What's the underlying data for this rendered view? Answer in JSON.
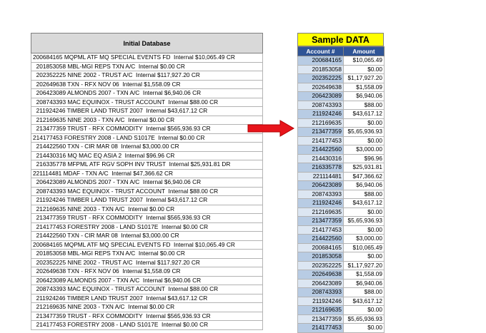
{
  "left": {
    "header": "Initial Database",
    "rows": [
      "200684165 MQPML ATF MQ SPECIAL EVENTS FD  Internal $10,065.49 CR",
      "  201853058 MBL-MGI REPS TXN A/C  Internal $0.00 CR",
      "  202352225 NINE 2002 - TRUST A/C  Internal $117,927.20 CR",
      "  202649638 TXN - RFX NOV 06  Internal $1,558.09 CR",
      "  206423089 ALMONDS 2007 - TXN A/C  Internal $6,940.06 CR",
      "  208743393 MAC EQUINOX - TRUST ACCOUNT  Internal $88.00 CR",
      "  211924246 TIMBER LAND TRUST 2007  Internal $43,617.12 CR",
      "  212169635 NINE 2003 - TXN A/C  Internal $0.00 CR",
      "  213477359 TRUST - RFX COMMODITY  Internal $565,936.93 CR",
      "214177453 FORESTRY 2008 - LAND S1017E  Internal $0.00 CR",
      "  214422560 TXN - CIR MAR 08  Internal $3,000.00 CR",
      "  214430316 MQ MAC EQ ASIA 2  Internal $96.96 CR",
      "  216335778 MFPML ATF RGV SOPH INV TRUST  Internal $25,931.81 DR",
      "221114481 MDAF - TXN A/C  Internal $47,366.62 CR",
      "  206423089 ALMONDS 2007 - TXN A/C  Internal $6,940.06 CR",
      "  208743393 MAC EQUINOX - TRUST ACCOUNT  Internal $88.00 CR",
      "  211924246 TIMBER LAND TRUST 2007  Internal $43,617.12 CR",
      "  212169635 NINE 2003 - TXN A/C  Internal $0.00 CR",
      "  213477359 TRUST - RFX COMMODITY  Internal $565,936.93 CR",
      "  214177453 FORESTRY 2008 - LAND S1017E  Internal $0.00 CR",
      "  214422560 TXN - CIR MAR 08  Internal $3,000.00 CR",
      "200684165 MQPML ATF MQ SPECIAL EVENTS FD  Internal $10,065.49 CR",
      "  201853058 MBL-MGI REPS TXN A/C  Internal $0.00 CR",
      "  202352225 NINE 2002 - TRUST A/C  Internal $117,927.20 CR",
      "  202649638 TXN - RFX NOV 06  Internal $1,558.09 CR",
      "  206423089 ALMONDS 2007 - TXN A/C  Internal $6,940.06 CR",
      "  208743393 MAC EQUINOX - TRUST ACCOUNT  Internal $88.00 CR",
      "  211924246 TIMBER LAND TRUST 2007  Internal $43,617.12 CR",
      "  212169635 NINE 2003 - TXN A/C  Internal $0.00 CR",
      "  213477359 TRUST - RFX COMMODITY  Internal $565,936.93 CR",
      "  214177453 FORESTRY 2008 - LAND S1017E  Internal $0.00 CR"
    ]
  },
  "right": {
    "title": "Sample DATA",
    "col_account": "Account #",
    "col_amount": "Amount",
    "rows": [
      {
        "account": "200684165",
        "amount": "$10,065.49",
        "hl": true
      },
      {
        "account": "201853058",
        "amount": "$0.00",
        "hl": false
      },
      {
        "account": "202352225",
        "amount": "$1,17,927.20",
        "hl": true
      },
      {
        "account": "202649638",
        "amount": "$1,558.09",
        "hl": false
      },
      {
        "account": "206423089",
        "amount": "$6,940.06",
        "hl": true
      },
      {
        "account": "208743393",
        "amount": "$88.00",
        "hl": false
      },
      {
        "account": "211924246",
        "amount": "$43,617.12",
        "hl": true
      },
      {
        "account": "212169635",
        "amount": "$0.00",
        "hl": false
      },
      {
        "account": "213477359",
        "amount": "$5,65,936.93",
        "hl": true
      },
      {
        "account": "214177453",
        "amount": "$0.00",
        "hl": false
      },
      {
        "account": "214422560",
        "amount": "$3,000.00",
        "hl": true
      },
      {
        "account": "214430316",
        "amount": "$96.96",
        "hl": false
      },
      {
        "account": "216335778",
        "amount": "$25,931.81",
        "hl": true
      },
      {
        "account": "221114481",
        "amount": "$47,366.62",
        "hl": false
      },
      {
        "account": "206423089",
        "amount": "$6,940.06",
        "hl": true
      },
      {
        "account": "208743393",
        "amount": "$88.00",
        "hl": false
      },
      {
        "account": "211924246",
        "amount": "$43,617.12",
        "hl": true
      },
      {
        "account": "212169635",
        "amount": "$0.00",
        "hl": false
      },
      {
        "account": "213477359",
        "amount": "$5,65,936.93",
        "hl": true
      },
      {
        "account": "214177453",
        "amount": "$0.00",
        "hl": false
      },
      {
        "account": "214422560",
        "amount": "$3,000.00",
        "hl": true
      },
      {
        "account": "200684165",
        "amount": "$10,065.49",
        "hl": false
      },
      {
        "account": "201853058",
        "amount": "$0.00",
        "hl": true
      },
      {
        "account": "202352225",
        "amount": "$1,17,927.20",
        "hl": false
      },
      {
        "account": "202649638",
        "amount": "$1,558.09",
        "hl": true
      },
      {
        "account": "206423089",
        "amount": "$6,940.06",
        "hl": false
      },
      {
        "account": "208743393",
        "amount": "$88.00",
        "hl": true
      },
      {
        "account": "211924246",
        "amount": "$43,617.12",
        "hl": false
      },
      {
        "account": "212169635",
        "amount": "$0.00",
        "hl": true
      },
      {
        "account": "213477359",
        "amount": "$5,65,936.93",
        "hl": false
      },
      {
        "account": "214177453",
        "amount": "$0.00",
        "hl": true
      }
    ]
  },
  "colors": {
    "title_bg": "#ffff00",
    "header_bg": "#2f5496",
    "arrow": "#e8141b"
  },
  "arrow_icon": "right-arrow-icon"
}
